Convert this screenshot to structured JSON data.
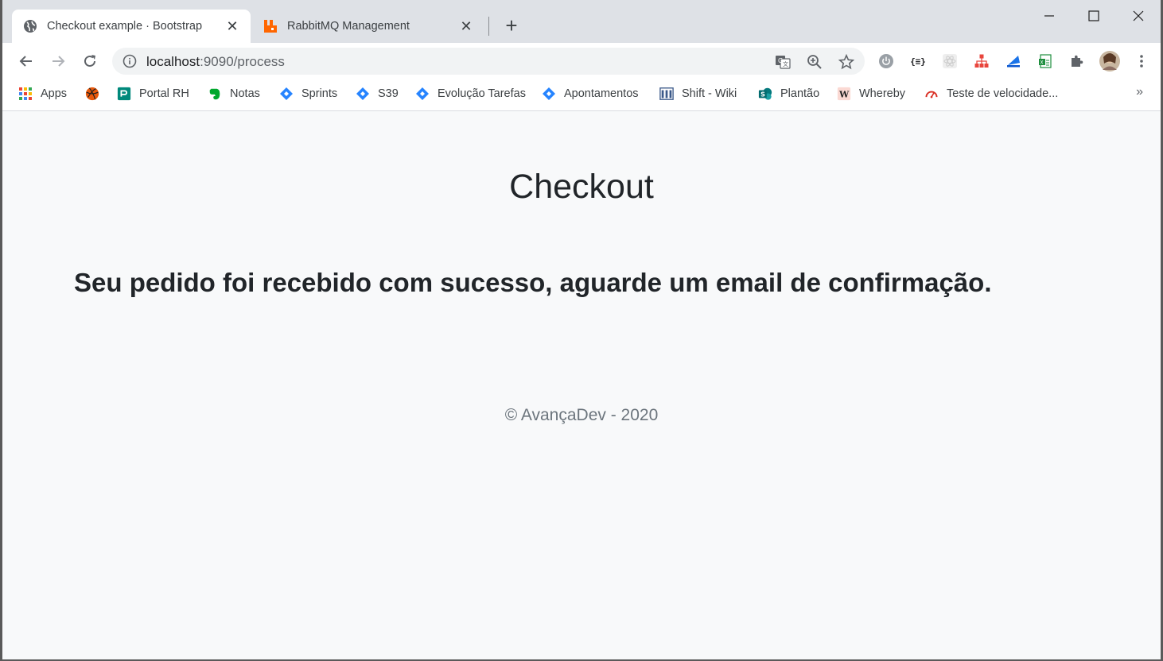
{
  "tabs": [
    {
      "title": "Checkout example · Bootstrap",
      "active": true
    },
    {
      "title": "RabbitMQ Management",
      "active": false
    }
  ],
  "address_bar": {
    "host": "localhost",
    "path": ":9090/process"
  },
  "bookmarks": {
    "apps": "Apps",
    "items": [
      "Portal RH",
      "Notas",
      "Sprints",
      "S39",
      "Evolução Tarefas",
      "Apontamentos",
      "Shift - Wiki",
      "Plantão",
      "Whereby",
      "Teste de velocidade..."
    ],
    "more": "»"
  },
  "page": {
    "title": "Checkout",
    "message": "Seu pedido foi recebido com sucesso, aguarde um email de confirmação.",
    "footer": "© AvançaDev - 2020"
  },
  "colors": {
    "tab_strip": "#dee1e6",
    "page_bg": "#f8f9fa",
    "text": "#212529",
    "muted": "#6c757d",
    "jira_blue": "#2684ff",
    "rabbit_orange": "#ff6600"
  },
  "icons": {
    "ext1": "{≡}"
  }
}
